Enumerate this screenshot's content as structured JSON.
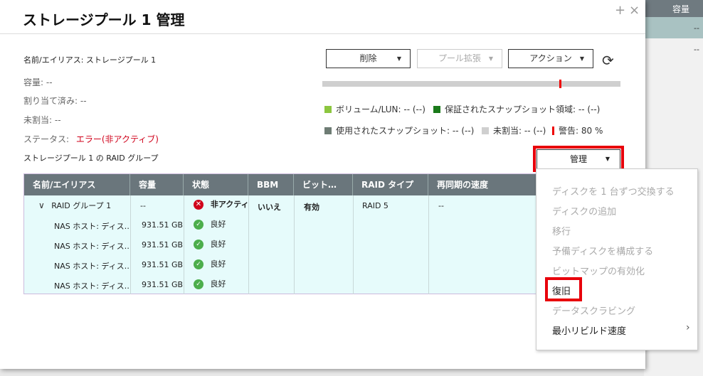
{
  "background": {
    "column_header": "容量",
    "row1_value": "--",
    "row2_value": "--"
  },
  "dialog": {
    "title": "ストレージプール 1 管理",
    "add_glyph": "+",
    "close_glyph": "×"
  },
  "info": {
    "name": "名前/エイリアス: ストレージプール 1",
    "capacity": "容量:  --",
    "allocated": "割り当て済み:  --",
    "unallocated": "未割当:  --",
    "status_label": "ステータス:",
    "status_value": "エラー(非アクティブ)",
    "raid_group_label": "ストレージプール 1 の RAID グループ"
  },
  "buttons": {
    "delete": "削除",
    "expand_pool": "プール拡張",
    "action": "アクション",
    "caret": "▼",
    "refresh_glyph": "⟳"
  },
  "legend": {
    "volume_lun": "ボリューム/LUN: -- (--)",
    "guaranteed_snapshot": "保証されたスナップショット領域: -- (--)",
    "used_snapshot": "使用されたスナップショット: -- (--)",
    "unallocated": "未割当: -- (--)",
    "warning": "警告: 80 %",
    "colors": {
      "volume": "#8cc63f",
      "guaranteed": "#1a7a1a",
      "used_snapshot": "#6e7c74",
      "unallocated": "#cfcfcf",
      "warning": "#e00000"
    }
  },
  "manage": {
    "label": "管理"
  },
  "table": {
    "headers": [
      "名前/エイリアス",
      "容量",
      "状態",
      "BBM",
      "ビット…",
      "RAID タイプ",
      "再同期の速度"
    ],
    "group_row": {
      "name": "RAID グループ 1",
      "capacity": "--",
      "status": "非アクティ",
      "bbm": "いいえ",
      "bitmap": "有効",
      "raid_type": "RAID 5",
      "resync": "--"
    },
    "disks": [
      {
        "name": "NAS ホスト: ディス…",
        "capacity": "931.51 GB…",
        "status": "良好"
      },
      {
        "name": "NAS ホスト: ディス…",
        "capacity": "931.51 GB…",
        "status": "良好"
      },
      {
        "name": "NAS ホスト: ディス…",
        "capacity": "931.51 GB…",
        "status": "良好"
      },
      {
        "name": "NAS ホスト: ディス…",
        "capacity": "931.51 GB…",
        "status": "良好"
      }
    ]
  },
  "menu": {
    "items": [
      "ディスクを 1 台ずつ交換する",
      "ディスクの追加",
      "移行",
      "予備ディスクを構成する",
      "ビットマップの有効化",
      "復旧",
      "データスクラビング",
      "最小リビルド速度"
    ],
    "submenu_arrow": "›"
  }
}
